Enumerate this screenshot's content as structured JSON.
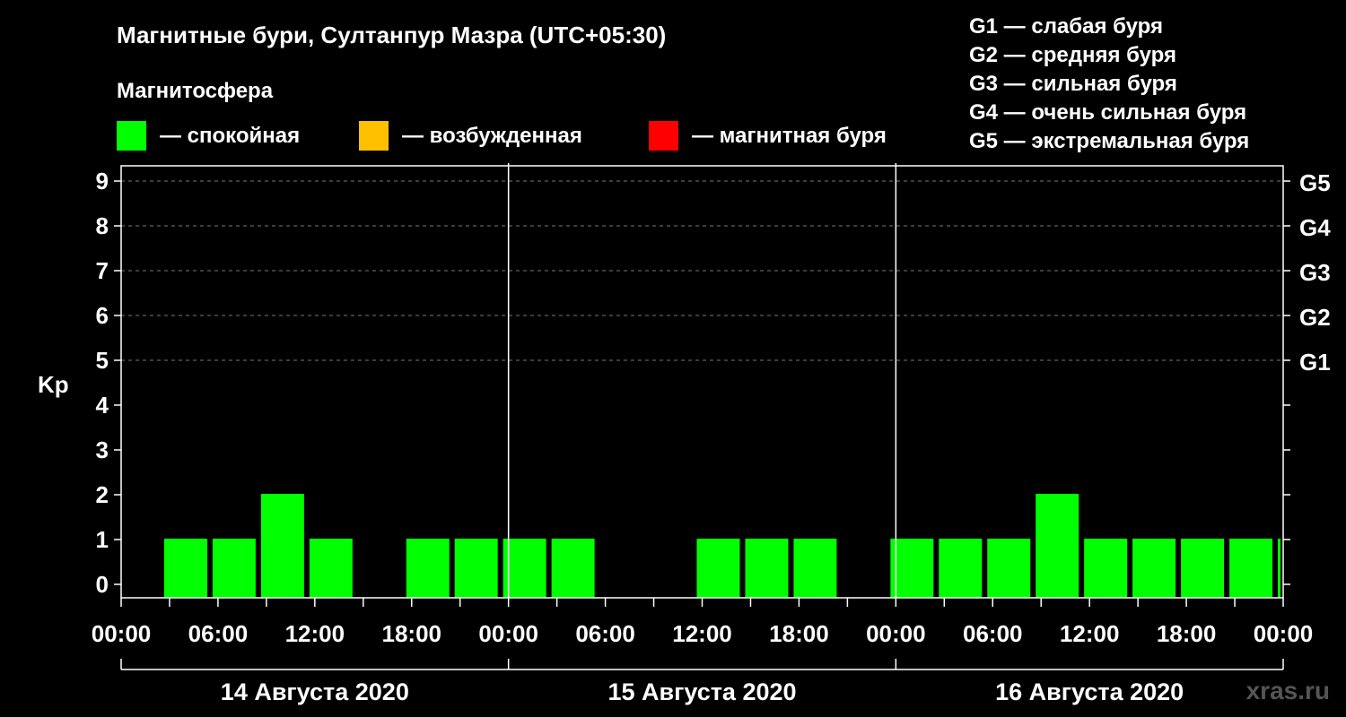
{
  "title": "Магнитные бури, Султанпур Мазра (UTC+05:30)",
  "legend": {
    "heading": "Магнитосфера",
    "items": [
      {
        "label": "— спокойная",
        "color": "#00ff00"
      },
      {
        "label": "— возбужденная",
        "color": "#ffc000"
      },
      {
        "label": "— магнитная буря",
        "color": "#ff0000"
      }
    ]
  },
  "g_scale": [
    "G1 — слабая буря",
    "G2 — средняя буря",
    "G3 — сильная буря",
    "G4 — очень сильная буря",
    "G5 — экстремальная буря"
  ],
  "watermark": "xras.ru",
  "chart_data": {
    "type": "bar",
    "ylabel": "Kp",
    "ylim": [
      0,
      9
    ],
    "yticks": [
      0,
      1,
      2,
      3,
      4,
      5,
      6,
      7,
      8,
      9
    ],
    "right_ticks": [
      {
        "kp": 5,
        "label": "G1"
      },
      {
        "kp": 6,
        "label": "G2"
      },
      {
        "kp": 7,
        "label": "G3"
      },
      {
        "kp": 8,
        "label": "G4"
      },
      {
        "kp": 9,
        "label": "G5"
      }
    ],
    "x_range_hours": [
      0,
      72
    ],
    "x_tick_labels": [
      "00:00",
      "06:00",
      "12:00",
      "18:00",
      "00:00",
      "06:00",
      "12:00",
      "18:00",
      "00:00",
      "06:00",
      "12:00",
      "18:00",
      "00:00"
    ],
    "days": [
      "14 Августа 2020",
      "15 Августа 2020",
      "16 Августа 2020"
    ],
    "interval_hours": 3,
    "interval_start_offset_hours": 2.5,
    "values": [
      1,
      1,
      2,
      1,
      0,
      1,
      1,
      1,
      1,
      0,
      0,
      1,
      1,
      1,
      0,
      1,
      1,
      1,
      2,
      1,
      1,
      1,
      1,
      1
    ],
    "color": "#00ff00",
    "grid": true
  }
}
